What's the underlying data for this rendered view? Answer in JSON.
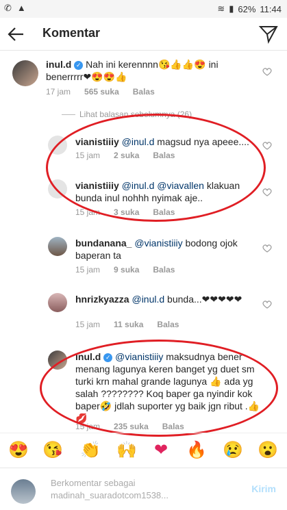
{
  "status_bar": {
    "battery": "62%",
    "time": "11:44"
  },
  "header": {
    "title": "Komentar"
  },
  "main_comment": {
    "username": "inul.d",
    "text": "Nah ini kerennnn😘👍👍😍 ini benerrrrr❤😍😍👍",
    "time": "17 jam",
    "likes": "565 suka",
    "reply": "Balas"
  },
  "load_previous": "Lihat balasan sebelumnya (26)",
  "replies": [
    {
      "username": "vianistiiiy",
      "mention": "@inul.d",
      "text": " magsud nya apeee....",
      "time": "15 jam",
      "likes": "2 suka",
      "reply": "Balas"
    },
    {
      "username": "vianistiiiy",
      "mention": "@inul.d @viavallen",
      "text": " klakuan bunda inul nohhh  nyimak aje..",
      "time": "15 jam",
      "likes": "3 suka",
      "reply": "Balas"
    },
    {
      "username": "bundanana_",
      "mention": "@vianistiiiy",
      "text": " bodong ojok baperan ta",
      "time": "15 jam",
      "likes": "9 suka",
      "reply": "Balas"
    },
    {
      "username": "hnrizkyazza",
      "mention": "@inul.d",
      "text": " bunda...❤❤❤❤❤",
      "time": "15 jam",
      "likes": "11 suka",
      "reply": "Balas"
    },
    {
      "username": "inul.d",
      "mention": "@vianistiiiy",
      "text": " maksudnya bener menang lagunya keren banget yg duet sm turki krn mahal grande lagunya 👍 ada yg salah ???????? Koq baper ga nyindir kok baper🤣 jdlah suporter yg baik jgn ribut .👍💋",
      "time": "15 jam",
      "likes": "235 suka",
      "reply": "Balas"
    }
  ],
  "emoji_bar": [
    "😍",
    "😘",
    "👏",
    "🙌",
    "❤",
    "🔥",
    "😢",
    "😮"
  ],
  "input": {
    "placeholder_line1": "Berkomentar sebagai",
    "placeholder_line2": "madinah_suaradotcom1538...",
    "post_label": "Kirim"
  },
  "colors": {
    "annotation": "#e01e24",
    "mention": "#003569",
    "verified": "#3897f0",
    "heart": "#e0245e"
  }
}
